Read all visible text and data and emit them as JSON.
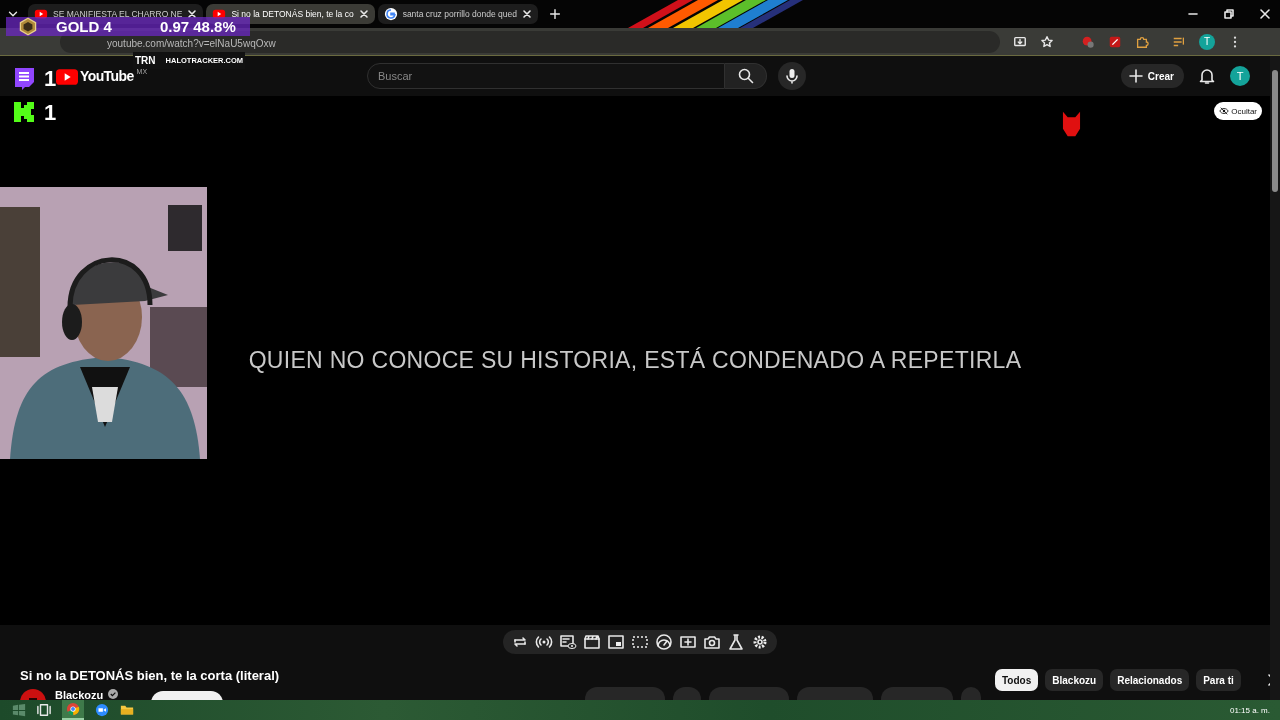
{
  "tabs": [
    {
      "kind": "youtube",
      "title": "SE MANIFIESTA EL CHARRO NE",
      "selected": false
    },
    {
      "kind": "youtube",
      "title": "Si no la DETONÁS bien, te la co",
      "selected": true
    },
    {
      "kind": "google",
      "title": "santa cruz porrillo donde qued",
      "selected": false
    }
  ],
  "address_bar": {
    "url": "youtube.com/watch?v=elNaU5wqOxw"
  },
  "browser_profile": {
    "letter": "T"
  },
  "stat_overlay": {
    "rank": "GOLD 4",
    "kd": "0.97",
    "win_rate": "48.8%",
    "brand": "TRN",
    "site": "HALOTRACKER.COM"
  },
  "header": {
    "logo": "YouTube",
    "region": "MX",
    "search": {
      "placeholder": "Buscar"
    },
    "create": "Crear",
    "avatar": "T"
  },
  "viewer_counts": [
    {
      "kind": "twitch",
      "count": "1"
    },
    {
      "kind": "kick",
      "count": "1"
    }
  ],
  "video": {
    "caption": "QUIEN NO CONOCE SU HISTORIA, ESTÁ CONDENADO A REPETIRLA",
    "hide_button": "Ocultar"
  },
  "title": "Si no la DETONÁS bien, te la corta (literal)",
  "channel": {
    "name": "Blackozu",
    "verified": true
  },
  "chips": [
    {
      "label": "Todos",
      "selected": true
    },
    {
      "label": "Blackozu",
      "selected": false
    },
    {
      "label": "Relacionados",
      "selected": false
    },
    {
      "label": "Para ti",
      "selected": false
    }
  ],
  "taskbar": {
    "clock": "01:15 a. m."
  }
}
